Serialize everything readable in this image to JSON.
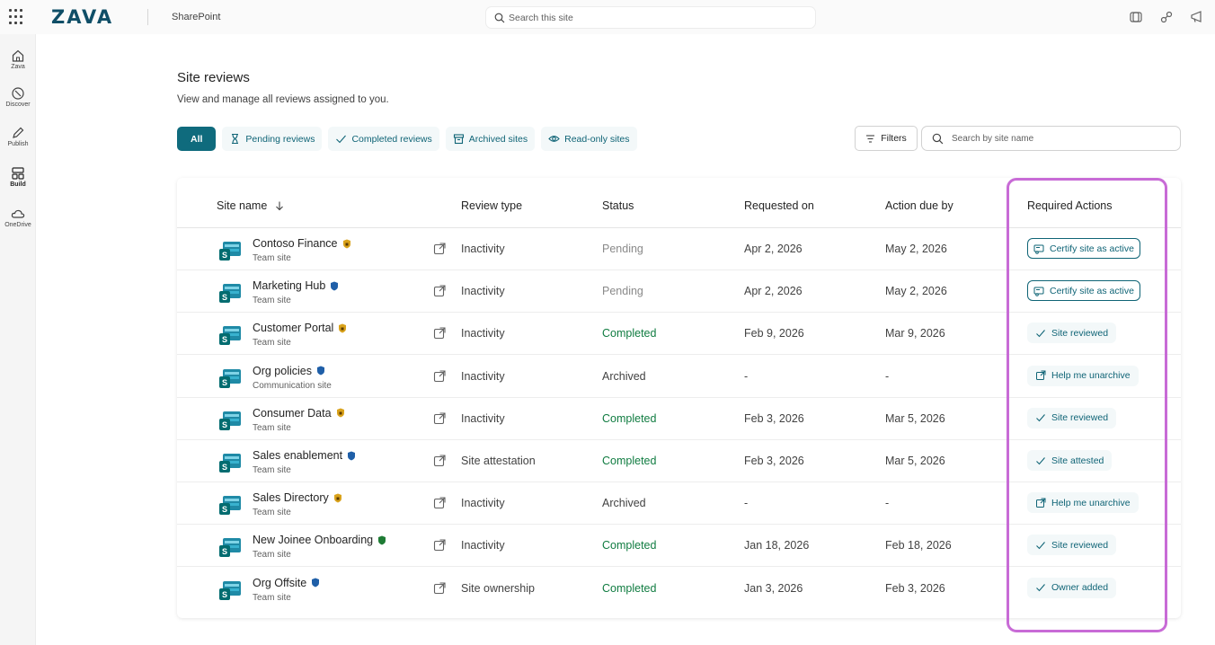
{
  "topbar": {
    "logo": "ZAVA",
    "app_name": "SharePoint",
    "search_placeholder": "Search this site"
  },
  "leftrail": [
    {
      "label": "Zava",
      "icon": "home-icon"
    },
    {
      "label": "Discover",
      "icon": "compass-icon"
    },
    {
      "label": "Publish",
      "icon": "pen-icon"
    },
    {
      "label": "Build",
      "icon": "layout-icon"
    },
    {
      "label": "OneDrive",
      "icon": "cloud-icon"
    }
  ],
  "page": {
    "title": "Site reviews",
    "subtitle": "View and manage all reviews assigned to you."
  },
  "filters": {
    "pills": [
      {
        "label": "All",
        "active": true
      },
      {
        "label": "Pending reviews",
        "icon": "hourglass-icon"
      },
      {
        "label": "Completed reviews",
        "icon": "check-icon"
      },
      {
        "label": "Archived sites",
        "icon": "archive-icon"
      },
      {
        "label": "Read-only sites",
        "icon": "eye-icon"
      }
    ],
    "filters_button": "Filters",
    "search_placeholder": "Search by site name"
  },
  "table": {
    "headers": {
      "site_name": "Site name",
      "review_type": "Review type",
      "status": "Status",
      "requested_on": "Requested on",
      "action_due_by": "Action due by",
      "required_actions": "Required Actions"
    },
    "rows": [
      {
        "name": "Contoso Finance",
        "badge": "gold",
        "kind": "Team site",
        "review_type": "Inactivity",
        "status": "Pending",
        "requested_on": "Apr 2, 2026",
        "due_by": "May 2, 2026",
        "action": "Certify site as active",
        "action_style": "outline"
      },
      {
        "name": "Marketing Hub",
        "badge": "blue",
        "kind": "Team site",
        "review_type": "Inactivity",
        "status": "Pending",
        "requested_on": "Apr 2, 2026",
        "due_by": "May 2, 2026",
        "action": "Certify site as active",
        "action_style": "outline"
      },
      {
        "name": "Customer Portal",
        "badge": "gold",
        "kind": "Team site",
        "review_type": "Inactivity",
        "status": "Completed",
        "requested_on": "Feb 9, 2026",
        "due_by": "Mar 9, 2026",
        "action": "Site reviewed",
        "action_style": "check"
      },
      {
        "name": "Org policies",
        "badge": "blue",
        "kind": "Communication site",
        "review_type": "Inactivity",
        "status": "Archived",
        "requested_on": "-",
        "due_by": "-",
        "action": "Help me unarchive",
        "action_style": "link"
      },
      {
        "name": "Consumer Data",
        "badge": "gold",
        "kind": "Team site",
        "review_type": "Inactivity",
        "status": "Completed",
        "requested_on": "Feb 3, 2026",
        "due_by": "Mar 5, 2026",
        "action": "Site reviewed",
        "action_style": "check"
      },
      {
        "name": "Sales enablement",
        "badge": "blue",
        "kind": "Team site",
        "review_type": "Site attestation",
        "status": "Completed",
        "requested_on": "Feb 3, 2026",
        "due_by": "Mar 5, 2026",
        "action": "Site attested",
        "action_style": "check"
      },
      {
        "name": "Sales Directory",
        "badge": "gold",
        "kind": "Team site",
        "review_type": "Inactivity",
        "status": "Archived",
        "requested_on": "-",
        "due_by": "-",
        "action": "Help me unarchive",
        "action_style": "link"
      },
      {
        "name": "New Joinee Onboarding",
        "badge": "green",
        "kind": "Team site",
        "review_type": "Inactivity",
        "status": "Completed",
        "requested_on": "Jan 18, 2026",
        "due_by": "Feb 18, 2026",
        "action": "Site reviewed",
        "action_style": "check"
      },
      {
        "name": "Org Offsite",
        "badge": "blue",
        "kind": "Team site",
        "review_type": "Site ownership",
        "status": "Completed",
        "requested_on": "Jan 3, 2026",
        "due_by": "Feb 3, 2026",
        "action": "Owner added",
        "action_style": "check"
      }
    ]
  },
  "colors": {
    "accent": "#0f6b7d",
    "completed": "#107c41",
    "highlight": "#c86bd6",
    "badge_gold": "#d9a21b",
    "badge_blue": "#1f5fa8",
    "badge_green": "#1e7b34"
  }
}
